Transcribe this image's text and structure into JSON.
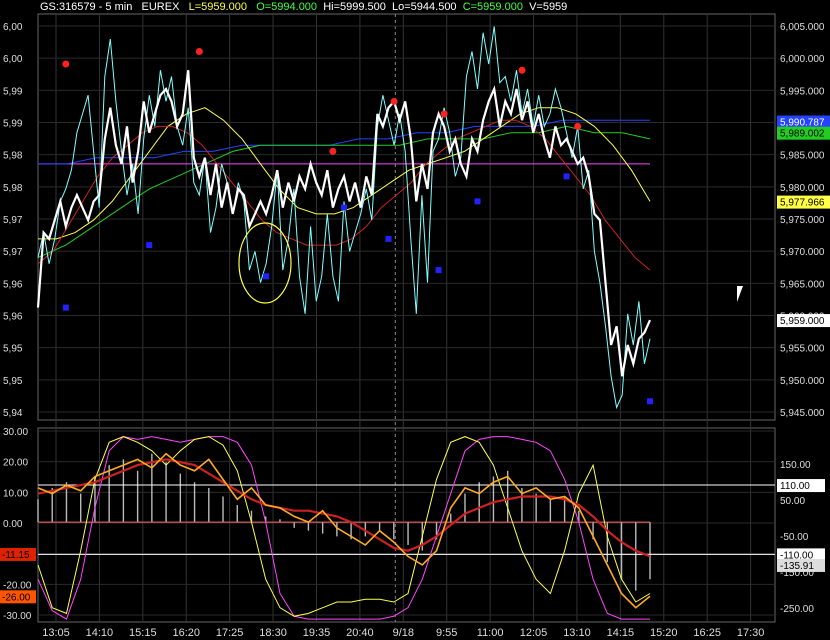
{
  "header": {
    "symbol": "GS:316579 - 5 min",
    "exchange": "EUREX",
    "last": "L=5959.000",
    "open": "O=5994.000",
    "high": "Hi=5999.500",
    "low": "Lo=5944.500",
    "close": "C=5959.000",
    "volume": "V=5959"
  },
  "colors": {
    "background": "#000000",
    "grid": "#555555",
    "price": "#ffffff",
    "price_alt": "#7fffff",
    "ma_fast": "#cc2222",
    "ma_mid": "#ffff44",
    "ma_slow": "#22cc22",
    "ma_long": "#2244ff",
    "horizontal_line": "#ff44ff",
    "dot_up": "#ff2222",
    "dot_down": "#2222ff"
  },
  "chart_data": [
    {
      "type": "line",
      "panel": "price",
      "x_ticks": [
        "13:05",
        "14:10",
        "15:15",
        "16:20",
        "17:25",
        "18:30",
        "19:35",
        "20:40",
        "9/18",
        "9:55",
        "11:00",
        "12:05",
        "13:10",
        "14:15",
        "15:20",
        "16:25",
        "17:30"
      ],
      "y_ticks_left": [
        "6,00",
        "6,00",
        "5,99",
        "5,99",
        "5,98",
        "5,98",
        "5,97",
        "5,97",
        "5,96",
        "5,96",
        "5,95",
        "5,95",
        "5,94"
      ],
      "y_ticks_right": [
        "6,005.000",
        "6,000.000",
        "5,995.000",
        "5,990.000",
        "5,985.000",
        "5,980.000",
        "5,975.000",
        "5,970.000",
        "5,965.000",
        "5,960.000",
        "5,955.000",
        "5,950.000",
        "5,945.000"
      ],
      "ylim": [
        5943,
        6008
      ],
      "value_labels": [
        {
          "text": "5,990.787",
          "value": 5990.787,
          "color": "#2244ff"
        },
        {
          "text": "5,989.002",
          "value": 5989.002,
          "color": "#22cc22"
        },
        {
          "text": "5,977.966",
          "value": 5977.966,
          "color": "#ffff44"
        },
        {
          "text": "5,959.000",
          "value": 5959.0,
          "color": "#ffffff"
        }
      ],
      "series": [
        {
          "color": "#ffffff",
          "values": [
            5961,
            5973,
            5972,
            5975,
            5978,
            5974,
            5977,
            5979,
            5977,
            5975,
            5978,
            5979,
            5988,
            5993,
            5987,
            5984,
            5990,
            5981,
            5986,
            5994,
            5989,
            5992,
            5995,
            5996,
            5994,
            5990,
            5992,
            5999,
            5985,
            5982,
            5985,
            5979,
            5984,
            5977,
            5981,
            5976,
            5980,
            5979,
            5974,
            5976,
            5978,
            5976,
            5979,
            5983,
            5977,
            5981,
            5978,
            5982,
            5980,
            5984,
            5981,
            5979,
            5983,
            5977,
            5980,
            5982,
            5978,
            5981,
            5977,
            5982,
            5979,
            5992,
            5990,
            5993,
            5994,
            5991,
            5994,
            5988,
            5978,
            5984,
            5980,
            5989,
            5992,
            5990,
            5986,
            5988,
            5984,
            5982,
            5988,
            5986,
            5991,
            5994,
            5996,
            5990,
            5994,
            5992,
            5996,
            5991,
            5994,
            5989,
            5992,
            5988,
            5985,
            5990,
            5987,
            5988,
            5986,
            5984,
            5985,
            5982,
            5976,
            5975,
            5965,
            5955,
            5958,
            5950,
            5955,
            5952,
            5956,
            5957,
            5959
          ]
        },
        {
          "color": "#7fffff",
          "values": [
            5969,
            5973,
            5968,
            5972,
            5978,
            5980,
            5983,
            5989,
            5992,
            5995,
            5986,
            5977,
            5998,
            6004,
            5994,
            5986,
            5979,
            5984,
            5976,
            5988,
            5995,
            5990,
            5999,
            5994,
            5998,
            5990,
            5987,
            5993,
            5981,
            5979,
            5985,
            5973,
            5977,
            5984,
            5981,
            5976,
            5981,
            5978,
            5967,
            5970,
            5965,
            5968,
            5974,
            5983,
            5967,
            5972,
            5980,
            5966,
            5960,
            5974,
            5962,
            5966,
            5976,
            5966,
            5962,
            5978,
            5970,
            5973,
            5976,
            5980,
            5975,
            5990,
            5995,
            5991,
            5987,
            5992,
            5986,
            5972,
            5960,
            5979,
            5965,
            5986,
            5988,
            5993,
            5989,
            5982,
            5985,
            5998,
            6002,
            5996,
            6005,
            6000,
            6006,
            5997,
            5998,
            5994,
            5999,
            5992,
            5996,
            5990,
            5995,
            5990,
            5992,
            5996,
            5993,
            5989,
            5985,
            5990,
            5980,
            5983,
            5970,
            5965,
            5958,
            5950,
            5945,
            5947,
            5960,
            5955,
            5962,
            5952,
            5956
          ]
        },
        {
          "color": "#cc2222",
          "values": [
            5968,
            5970,
            5974,
            5978,
            5982,
            5985,
            5987,
            5989,
            5990,
            5990,
            5989,
            5987,
            5984,
            5981,
            5978,
            5975,
            5973,
            5972,
            5971,
            5971,
            5971,
            5972,
            5974,
            5977,
            5979,
            5981,
            5984,
            5986,
            5988,
            5989,
            5990,
            5991,
            5991,
            5990,
            5988,
            5985,
            5982,
            5979,
            5975,
            5972,
            5969,
            5967
          ]
        },
        {
          "color": "#ffff44",
          "values": [
            5972,
            5972,
            5973,
            5975,
            5978,
            5982,
            5986,
            5990,
            5992,
            5993,
            5991,
            5988,
            5984,
            5980,
            5977,
            5976,
            5976,
            5977,
            5979,
            5981,
            5983,
            5984,
            5985,
            5986,
            5988,
            5990,
            5992,
            5993,
            5993,
            5992,
            5990,
            5987,
            5983,
            5978
          ]
        },
        {
          "color": "#22cc22",
          "values": [
            5969,
            5971,
            5974,
            5977,
            5980,
            5982,
            5984,
            5986,
            5987,
            5987,
            5987,
            5987,
            5987,
            5987,
            5988,
            5988,
            5988,
            5989,
            5989,
            5990,
            5989,
            5989,
            5988
          ]
        },
        {
          "color": "#2244ff",
          "values": [
            5984,
            5984,
            5985,
            5985,
            5985,
            5986,
            5986,
            5987,
            5987,
            5987,
            5987,
            5988,
            5988,
            5989,
            5989,
            5990,
            5990,
            5990,
            5991,
            5991,
            5991,
            5991
          ]
        },
        {
          "color": "#ff44ff",
          "values": [
            5984,
            5984
          ]
        }
      ],
      "dots": [
        {
          "i": 5,
          "value": 6000,
          "color": "#ff2222"
        },
        {
          "i": 29,
          "value": 6002,
          "color": "#ff2222"
        },
        {
          "i": 53,
          "value": 5986,
          "color": "#ff2222"
        },
        {
          "i": 64,
          "value": 5994,
          "color": "#ff2222"
        },
        {
          "i": 73,
          "value": 5992,
          "color": "#ff2222"
        },
        {
          "i": 87,
          "value": 5999,
          "color": "#ff2222"
        },
        {
          "i": 97,
          "value": 5990,
          "color": "#ff2222"
        },
        {
          "i": 5,
          "value": 5961,
          "color": "#2222ff"
        },
        {
          "i": 20,
          "value": 5971,
          "color": "#2222ff"
        },
        {
          "i": 41,
          "value": 5966,
          "color": "#2222ff"
        },
        {
          "i": 55,
          "value": 5977,
          "color": "#2222ff"
        },
        {
          "i": 63,
          "value": 5972,
          "color": "#2222ff"
        },
        {
          "i": 72,
          "value": 5967,
          "color": "#2222ff"
        },
        {
          "i": 79,
          "value": 5978,
          "color": "#2222ff"
        },
        {
          "i": 95,
          "value": 5982,
          "color": "#2222ff"
        },
        {
          "i": 110,
          "value": 5946,
          "color": "#2222ff"
        }
      ]
    },
    {
      "type": "line",
      "panel": "oscillator",
      "y_ticks_left": [
        "30.00",
        "20.00",
        "10.00",
        "0.00",
        "-10.00",
        "-20.00",
        "-30.00"
      ],
      "y_ticks_right": [
        "150.00",
        "50.00",
        "-50.00",
        "-150.00",
        "-250.00"
      ],
      "ylim": [
        -35,
        33
      ],
      "value_labels_left": [
        {
          "text": "-11.15",
          "value": -11.15,
          "color": "#dd2200"
        },
        {
          "text": "-26.00",
          "value": -26.0,
          "color": "#ff5500"
        }
      ],
      "value_labels_right": [
        {
          "text": "110.00",
          "value": 13.0,
          "color": "#ffffff"
        },
        {
          "text": "-110.00",
          "value": -11.3,
          "color": "#ffffff"
        },
        {
          "text": "-135.91",
          "value": -15.0,
          "color": "#dddddd"
        }
      ],
      "series": [
        {
          "color": "#ff44ff",
          "values": [
            -20,
            -31,
            -34,
            -20,
            5,
            25,
            30,
            29,
            30,
            29,
            28,
            29,
            30,
            30,
            28,
            20,
            0,
            -25,
            -33,
            -34,
            -34,
            -34,
            -34,
            -34,
            -34,
            -33,
            -30,
            -20,
            -5,
            10,
            25,
            29,
            30,
            30,
            29,
            28,
            25,
            15,
            0,
            -20,
            -32,
            -34,
            -34,
            -34
          ]
        },
        {
          "color": "#ffff44",
          "values": [
            -15,
            -30,
            -32,
            -10,
            15,
            28,
            30,
            28,
            25,
            20,
            25,
            29,
            30,
            27,
            18,
            0,
            -20,
            -30,
            -33,
            -32,
            -30,
            -28,
            -28,
            -27,
            -27,
            -28,
            -25,
            -5,
            15,
            28,
            30,
            28,
            20,
            5,
            -10,
            -20,
            -25,
            -10,
            10,
            20,
            -5,
            -20,
            -28,
            -25
          ]
        },
        {
          "color": "#cc2222",
          "values": [
            10,
            11,
            12,
            13,
            14,
            16,
            18,
            20,
            21,
            22,
            21,
            20,
            17,
            14,
            11,
            8,
            6,
            5,
            4,
            4,
            3,
            2,
            0,
            -3,
            -6,
            -9,
            -10,
            -8,
            -5,
            -1,
            3,
            5,
            7,
            8,
            9,
            9,
            9,
            8,
            6,
            2,
            -3,
            -7,
            -10,
            -12
          ]
        },
        {
          "color": "#ffaa22",
          "values": [
            12,
            10,
            13,
            11,
            16,
            18,
            20,
            22,
            19,
            24,
            20,
            18,
            22,
            15,
            8,
            12,
            6,
            5,
            2,
            0,
            4,
            -2,
            -5,
            -8,
            -3,
            -7,
            -12,
            -15,
            -10,
            5,
            12,
            10,
            14,
            16,
            10,
            12,
            8,
            9,
            5,
            -5,
            -15,
            -25,
            -30,
            -26
          ]
        }
      ],
      "histogram": [
        8,
        12,
        14,
        10,
        16,
        20,
        22,
        18,
        24,
        21,
        17,
        14,
        12,
        9,
        6,
        4,
        2,
        1,
        -2,
        -3,
        -4,
        -5,
        -6,
        -5,
        -3,
        -6,
        -8,
        -10,
        -6,
        3,
        10,
        14,
        16,
        18,
        12,
        10,
        8,
        9,
        4,
        -6,
        -14,
        -20,
        -24,
        -20
      ]
    }
  ]
}
